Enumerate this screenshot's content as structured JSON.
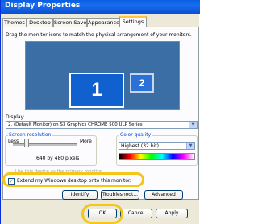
{
  "window": {
    "title": "Display Properties"
  },
  "tabs": [
    {
      "label": "Themes"
    },
    {
      "label": "Desktop"
    },
    {
      "label": "Screen Saver"
    },
    {
      "label": "Appearance"
    },
    {
      "label": "Settings"
    }
  ],
  "active_tab": "Settings",
  "settings": {
    "instruction": "Drag the monitor icons to match the physical arrangement of your monitors.",
    "monitors": [
      {
        "number": "1"
      },
      {
        "number": "2"
      }
    ],
    "display_label": "Display:",
    "display_value": "2. (Default Monitor) on S3 Graphics CHROME 500 ULP Series",
    "screen_resolution": {
      "title": "Screen resolution",
      "less_label": "Less",
      "more_label": "More",
      "value_text": "640 by 480 pixels",
      "slider_level": 0.2
    },
    "color_quality": {
      "title": "Color quality",
      "value": "Highest (32 bit)"
    },
    "primary_monitor_label": "Use this device as the primary monitor.",
    "extend_desktop_label": "Extend my Windows desktop onto this monitor.",
    "extend_desktop_checked": true,
    "identify_label": "Identify",
    "troubleshoot_label": "Troubleshoot...",
    "advanced_label": "Advanced"
  },
  "footer": {
    "ok_label": "OK",
    "cancel_label": "Cancel",
    "apply_label": "Apply"
  },
  "colors": {
    "highlight": "#f5c518",
    "titlebar": "#0a5fe0",
    "monitor_fill": "#1060d0"
  }
}
